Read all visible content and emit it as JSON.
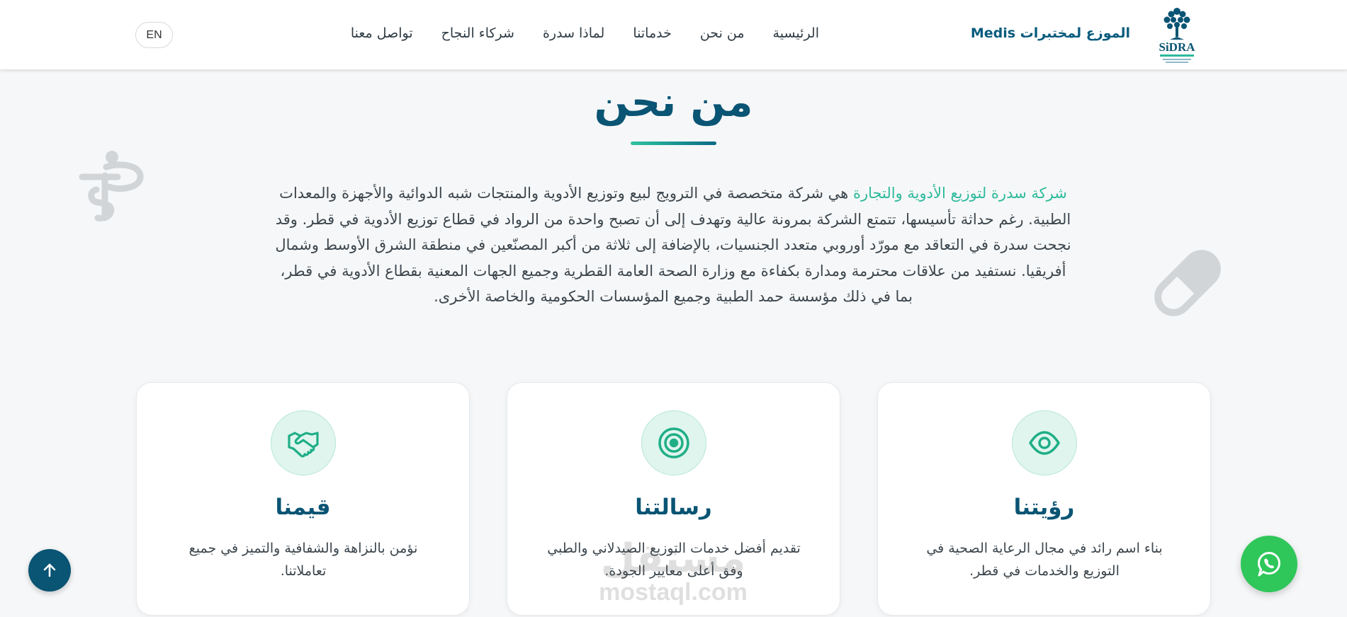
{
  "header": {
    "brand_name": "الموزع لمختبرات Medis",
    "logo_text": "SiDRA",
    "nav": [
      {
        "label": "الرئيسية"
      },
      {
        "label": "من نحن"
      },
      {
        "label": "خدماتنا"
      },
      {
        "label": "لماذا سدرة"
      },
      {
        "label": "شركاء النجاح"
      },
      {
        "label": "تواصل معنا"
      }
    ],
    "lang_label": "EN"
  },
  "about": {
    "title": "من نحن",
    "intro_highlight": "شركة سدرة لتوزيع الأدوية والتجارة",
    "intro_rest": " هي شركة متخصصة في الترويج لبيع وتوزيع الأدوية والمنتجات شبه الدوائية والأجهزة والمعدات الطبية. رغم حداثة تأسيسها، تتمتع الشركة بمرونة عالية وتهدف إلى أن تصبح واحدة من الرواد في قطاع توزيع الأدوية في قطر. وقد نجحت سدرة في التعاقد مع مورّد أوروبي متعدد الجنسيات، بالإضافة إلى ثلاثة من أكبر المصنّعين في منطقة الشرق الأوسط وشمال أفريقيا. نستفيد من علاقات محترمة ومدارة بكفاءة مع وزارة الصحة العامة القطرية وجميع الجهات المعنية بقطاع الأدوية في قطر، بما في ذلك مؤسسة حمد الطبية وجميع المؤسسات الحكومية والخاصة الأخرى."
  },
  "cards": [
    {
      "icon": "eye-icon",
      "title": "رؤيتنا",
      "text": "بناء اسم رائد في مجال الرعاية الصحية في التوزيع والخدمات في قطر."
    },
    {
      "icon": "target-icon",
      "title": "رسالتنا",
      "text": "تقديم أفضل خدمات التوزيع الصيدلاني والطبي وفق أعلى معايير الجودة."
    },
    {
      "icon": "handshake-icon",
      "title": "قيمنا",
      "text": "نؤمن بالنزاهة والشفافية والتميز في جميع تعاملاتنا."
    }
  ],
  "watermark": {
    "arabic": "مستقل",
    "latin": "mostaql.com"
  },
  "colors": {
    "primary": "#0a5474",
    "accent": "#2dba9c",
    "whatsapp": "#2fc65a",
    "background": "#f6f7f8"
  }
}
